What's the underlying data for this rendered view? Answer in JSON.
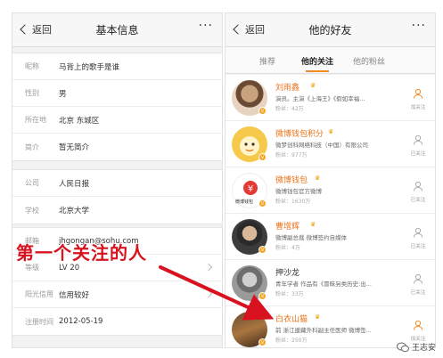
{
  "left_screen": {
    "back_label": "返回",
    "title": "基本信息",
    "more": "···",
    "groups": [
      [
        {
          "label": "昵称",
          "value": "马背上的歌手是谁"
        },
        {
          "label": "性别",
          "value": "男"
        },
        {
          "label": "所在地",
          "value": "北京 东城区"
        },
        {
          "label": "简介",
          "value": "暂无简介"
        }
      ],
      [
        {
          "label": "公司",
          "value": "人民日报"
        },
        {
          "label": "学校",
          "value": "北京大学"
        }
      ],
      [
        {
          "label": "邮箱",
          "value": "jhgongan@sohu.com"
        },
        {
          "label": "等级",
          "value": "LV 20"
        },
        {
          "label": "阳光信用",
          "value": "信用较好"
        },
        {
          "label": "注册时间",
          "value": "2012-05-19"
        }
      ]
    ]
  },
  "right_screen": {
    "back_label": "返回",
    "title": "他的好友",
    "more": "···",
    "tabs": [
      "推荐",
      "他的关注",
      "他的粉丝"
    ],
    "active_tab": 1,
    "friends": [
      {
        "name": "刘雨鑫",
        "desc": "演员。主演《上海王》《假如幸福...",
        "fans": "粉丝：42万",
        "follow": "加关注"
      },
      {
        "name": "微博钱包积分",
        "desc": "微梦创科网络科技（中国）有限公司",
        "fans": "粉丝：977万",
        "follow": "已关注"
      },
      {
        "name": "微博钱包",
        "desc": "微博钱包官方微博",
        "fans": "粉丝：1630万",
        "follow": "已关注",
        "avatar_caption": "微博钱包"
      },
      {
        "name": "曹增辉",
        "desc": "微博副总裁 微博签约自媒体",
        "fans": "粉丝：4万",
        "follow": "已关注"
      },
      {
        "name": "押沙龙",
        "desc": "青年学者 作品有《冒昧另类历史:出...",
        "fans": "粉丝：33万",
        "follow": "已关注"
      },
      {
        "name": "白衣山猫",
        "desc": "前 浙江援藏外科副主任医师 微博签...",
        "fans": "粉丝：250万",
        "follow": "加关注"
      }
    ]
  },
  "annotation": {
    "text": "第一个关注的人",
    "color": "#d8121e"
  },
  "watermark": {
    "text": "王志安"
  },
  "colors": {
    "name_orange": "#e8731b",
    "tab_underline": "#f08a24",
    "verified_badge": "#f5a623"
  }
}
